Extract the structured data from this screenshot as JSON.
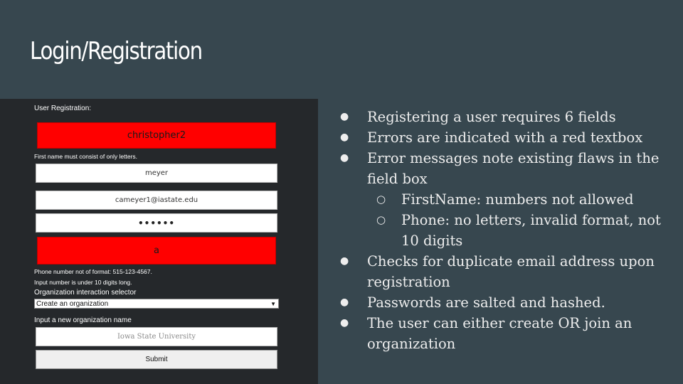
{
  "slide": {
    "title": "Login/Registration"
  },
  "form": {
    "heading": "User Registration:",
    "first_name_value": "christopher2",
    "first_name_error": "First name must consist of only letters.",
    "last_name_value": "meyer",
    "email_value": "cameyer1@iastate.edu",
    "password_value": "••••••",
    "phone_value": "a",
    "phone_error_format": "Phone number not of format: 515-123-4567.",
    "phone_error_length": "Input number is under 10 digits long.",
    "org_selector_label": "Organization interaction selector",
    "org_selector_value": "Create an organization",
    "new_org_label": "Input a new organization name",
    "new_org_placeholder": "Iowa State University",
    "submit_label": "Submit",
    "error_color": "#ff0000"
  },
  "bullets": {
    "b1": "Registering a user requires 6 fields",
    "b2": "Errors are indicated with a red textbox",
    "b3": "Error messages note existing flaws in the field box",
    "b3_sub1": "FirstName: numbers not allowed",
    "b3_sub2": "Phone: no letters, invalid format, not 10 digits",
    "b4": "Checks for duplicate email address upon registration",
    "b5": "Passwords are salted and hashed.",
    "b6": "The user can either create OR join an organization"
  }
}
